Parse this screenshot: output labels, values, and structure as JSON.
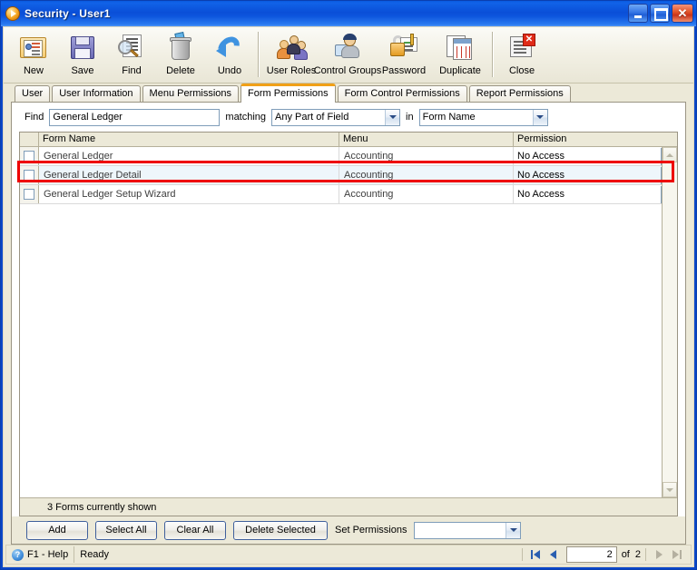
{
  "window": {
    "title": "Security - User1",
    "icon": "play-circle-icon",
    "controls": {
      "minimize": "minimize-button",
      "maximize": "maximize-button",
      "close_glyph": "✕"
    }
  },
  "toolbar": {
    "items": [
      {
        "label": "New",
        "icon": "new-user-icon"
      },
      {
        "label": "Save",
        "icon": "floppy-disk-icon"
      },
      {
        "label": "Find",
        "icon": "magnifier-icon"
      },
      {
        "label": "Delete",
        "icon": "trash-can-icon"
      },
      {
        "label": "Undo",
        "icon": "undo-arrow-icon"
      },
      {
        "label": "User Roles",
        "icon": "users-group-icon"
      },
      {
        "label": "Control Groups",
        "icon": "user-computer-icon"
      },
      {
        "label": "Password",
        "icon": "padlock-key-icon"
      },
      {
        "label": "Duplicate",
        "icon": "duplicate-documents-icon"
      },
      {
        "label": "Close",
        "icon": "close-document-icon"
      }
    ]
  },
  "tabs": [
    {
      "label": "User",
      "active": false
    },
    {
      "label": "User Information",
      "active": false
    },
    {
      "label": "Menu Permissions",
      "active": false
    },
    {
      "label": "Form Permissions",
      "active": true
    },
    {
      "label": "Form Control Permissions",
      "active": false
    },
    {
      "label": "Report Permissions",
      "active": false
    }
  ],
  "find": {
    "find_label": "Find",
    "query": "General Ledger",
    "matching_label": "matching",
    "match_mode": "Any Part of Field",
    "in_label": "in",
    "field": "Form Name"
  },
  "grid": {
    "columns": [
      "",
      "Form Name",
      "Menu",
      "Permission"
    ],
    "rows": [
      {
        "checked": false,
        "form_name": "General Ledger",
        "menu": "Accounting",
        "permission": "No Access"
      },
      {
        "checked": false,
        "form_name": "General Ledger Detail",
        "menu": "Accounting",
        "permission": "No Access"
      },
      {
        "checked": false,
        "form_name": "General Ledger Setup Wizard",
        "menu": "Accounting",
        "permission": "No Access"
      }
    ],
    "footer": "3 Forms currently shown"
  },
  "actions": {
    "add": "Add",
    "select_all": "Select All",
    "clear_all": "Clear All",
    "delete_selected": "Delete Selected",
    "set_permissions_label": "Set Permissions",
    "set_permissions_value": ""
  },
  "statusbar": {
    "help": "F1 - Help",
    "help_icon": "question-help-icon",
    "state": "Ready",
    "current_page": "2",
    "of_label": "of",
    "total_pages": "2"
  },
  "colors": {
    "accent_tab": "#f0a018",
    "titlebar": "#0a4fd8",
    "annotation": "#ee0000",
    "face": "#ece9d8"
  }
}
